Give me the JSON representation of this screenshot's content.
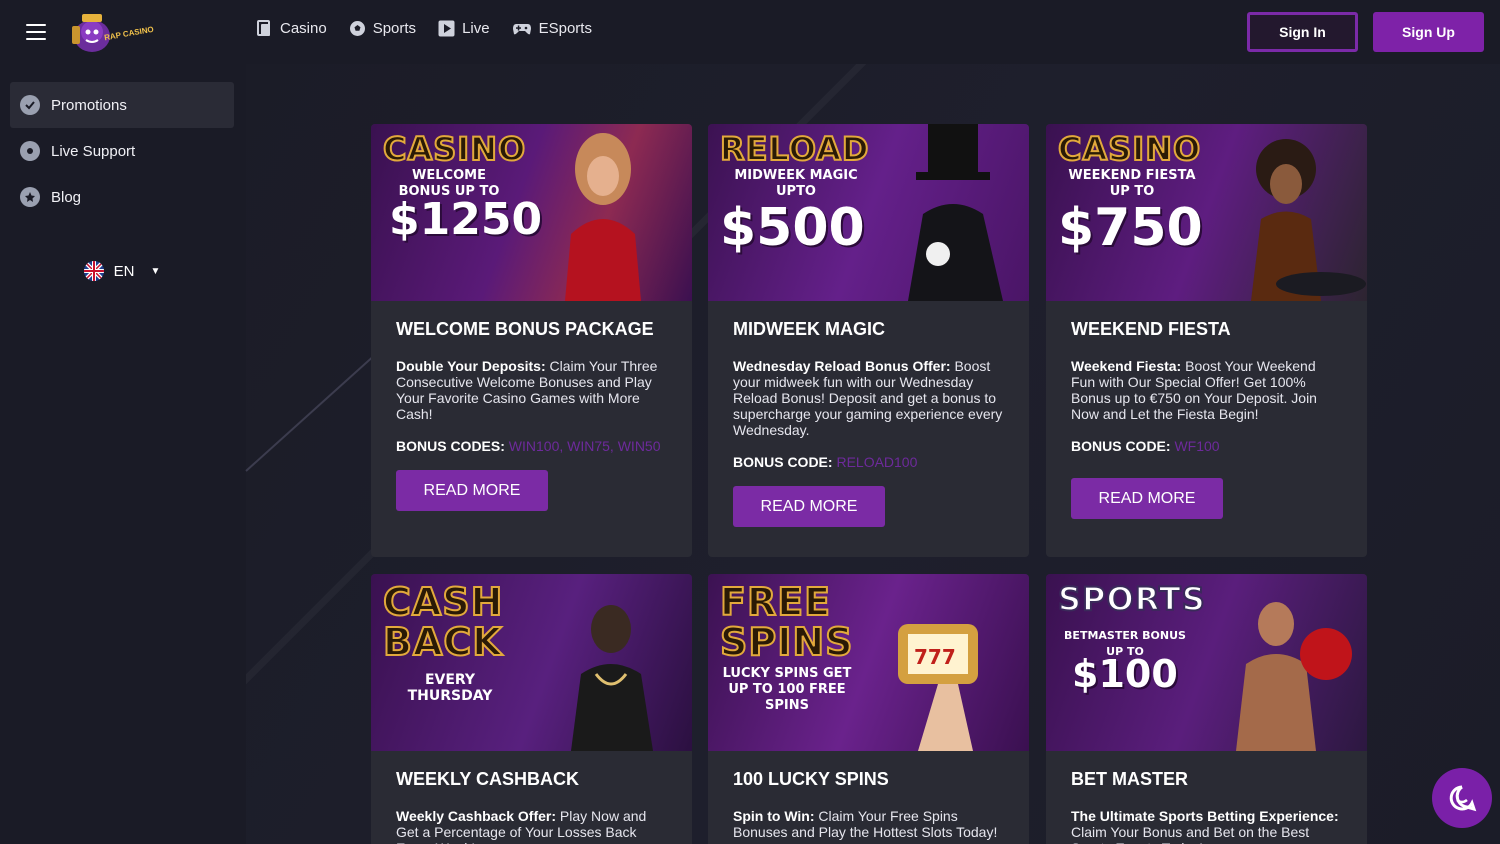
{
  "header": {
    "logo_text": "RAP CASINO",
    "nav": [
      {
        "label": "Casino",
        "icon": "casino-icon"
      },
      {
        "label": "Sports",
        "icon": "soccer-ball-icon"
      },
      {
        "label": "Live",
        "icon": "play-icon"
      },
      {
        "label": "ESports",
        "icon": "gamepad-icon"
      }
    ],
    "sign_in": "Sign In",
    "sign_up": "Sign Up"
  },
  "sidebar": {
    "items": [
      {
        "label": "Promotions",
        "icon": "promo-badge-icon",
        "active": true
      },
      {
        "label": "Live Support",
        "icon": "support-icon"
      },
      {
        "label": "Blog",
        "icon": "blog-icon"
      }
    ],
    "language": "EN"
  },
  "cards": [
    {
      "banner_title": "CASINO",
      "banner_sub": "WELCOME BONUS UP TO",
      "banner_amount": "$1250",
      "title": "WELCOME BONUS PACKAGE",
      "desc_bold": "Double Your Deposits:",
      "desc": " Claim Your Three Consecutive Welcome Bonuses and Play Your Favorite Casino Games with More Cash!",
      "codes_label": "BONUS CODES:",
      "codes": "WIN100, WIN75, WIN50",
      "button": "READ MORE"
    },
    {
      "banner_title": "RELOAD",
      "banner_sub": "MIDWEEK MAGIC UPTO",
      "banner_amount": "$500",
      "title": "MIDWEEK MAGIC",
      "desc_bold": "Wednesday Reload Bonus Offer:",
      "desc": " Boost your midweek fun with our Wednesday Reload Bonus! Deposit and get a bonus to supercharge your gaming experience every Wednesday.",
      "codes_label": "BONUS CODE:",
      "codes": "RELOAD100",
      "button": "READ MORE"
    },
    {
      "banner_title": "CASINO",
      "banner_sub": "WEEKEND FIESTA UP TO",
      "banner_amount": "$750",
      "title": "WEEKEND FIESTA",
      "desc_bold": "Weekend Fiesta:",
      "desc": " Boost Your Weekend Fun with Our Special Offer! Get 100% Bonus up to €750 on Your Deposit. Join Now and Let the Fiesta Begin!",
      "codes_label": "BONUS CODE:",
      "codes": "WF100",
      "button": "READ MORE"
    },
    {
      "banner_title": "CASH BACK",
      "banner_sub": "EVERY THURSDAY",
      "banner_amount": "",
      "title": "WEEKLY CASHBACK",
      "desc_bold": "Weekly Cashback Offer:",
      "desc": " Play Now and Get a Percentage of Your Losses Back Every Week!",
      "codes_label": "",
      "codes": "",
      "button": ""
    },
    {
      "banner_title": "FREE SPINS",
      "banner_sub": "LUCKY SPINS GET UP TO 100 FREE SPINS",
      "banner_amount": "",
      "title": "100 LUCKY SPINS",
      "desc_bold": "Spin to Win:",
      "desc": " Claim Your Free Spins Bonuses and Play the Hottest Slots Today!",
      "codes_label": "",
      "codes": "",
      "button": ""
    },
    {
      "banner_title": "SPORTS",
      "banner_sub": "BETMASTER BONUS UP TO",
      "banner_amount": "$100",
      "title": "BET MASTER",
      "desc_bold": "The Ultimate Sports Betting Experience:",
      "desc": " Claim Your Bonus and Bet on the Best Sports Events Today!",
      "codes_label": "",
      "codes": "",
      "button": ""
    }
  ],
  "colors": {
    "accent": "#7e22a8",
    "background": "#1a1b26",
    "card": "#2a2b34",
    "code_text": "#6d2a9b"
  }
}
